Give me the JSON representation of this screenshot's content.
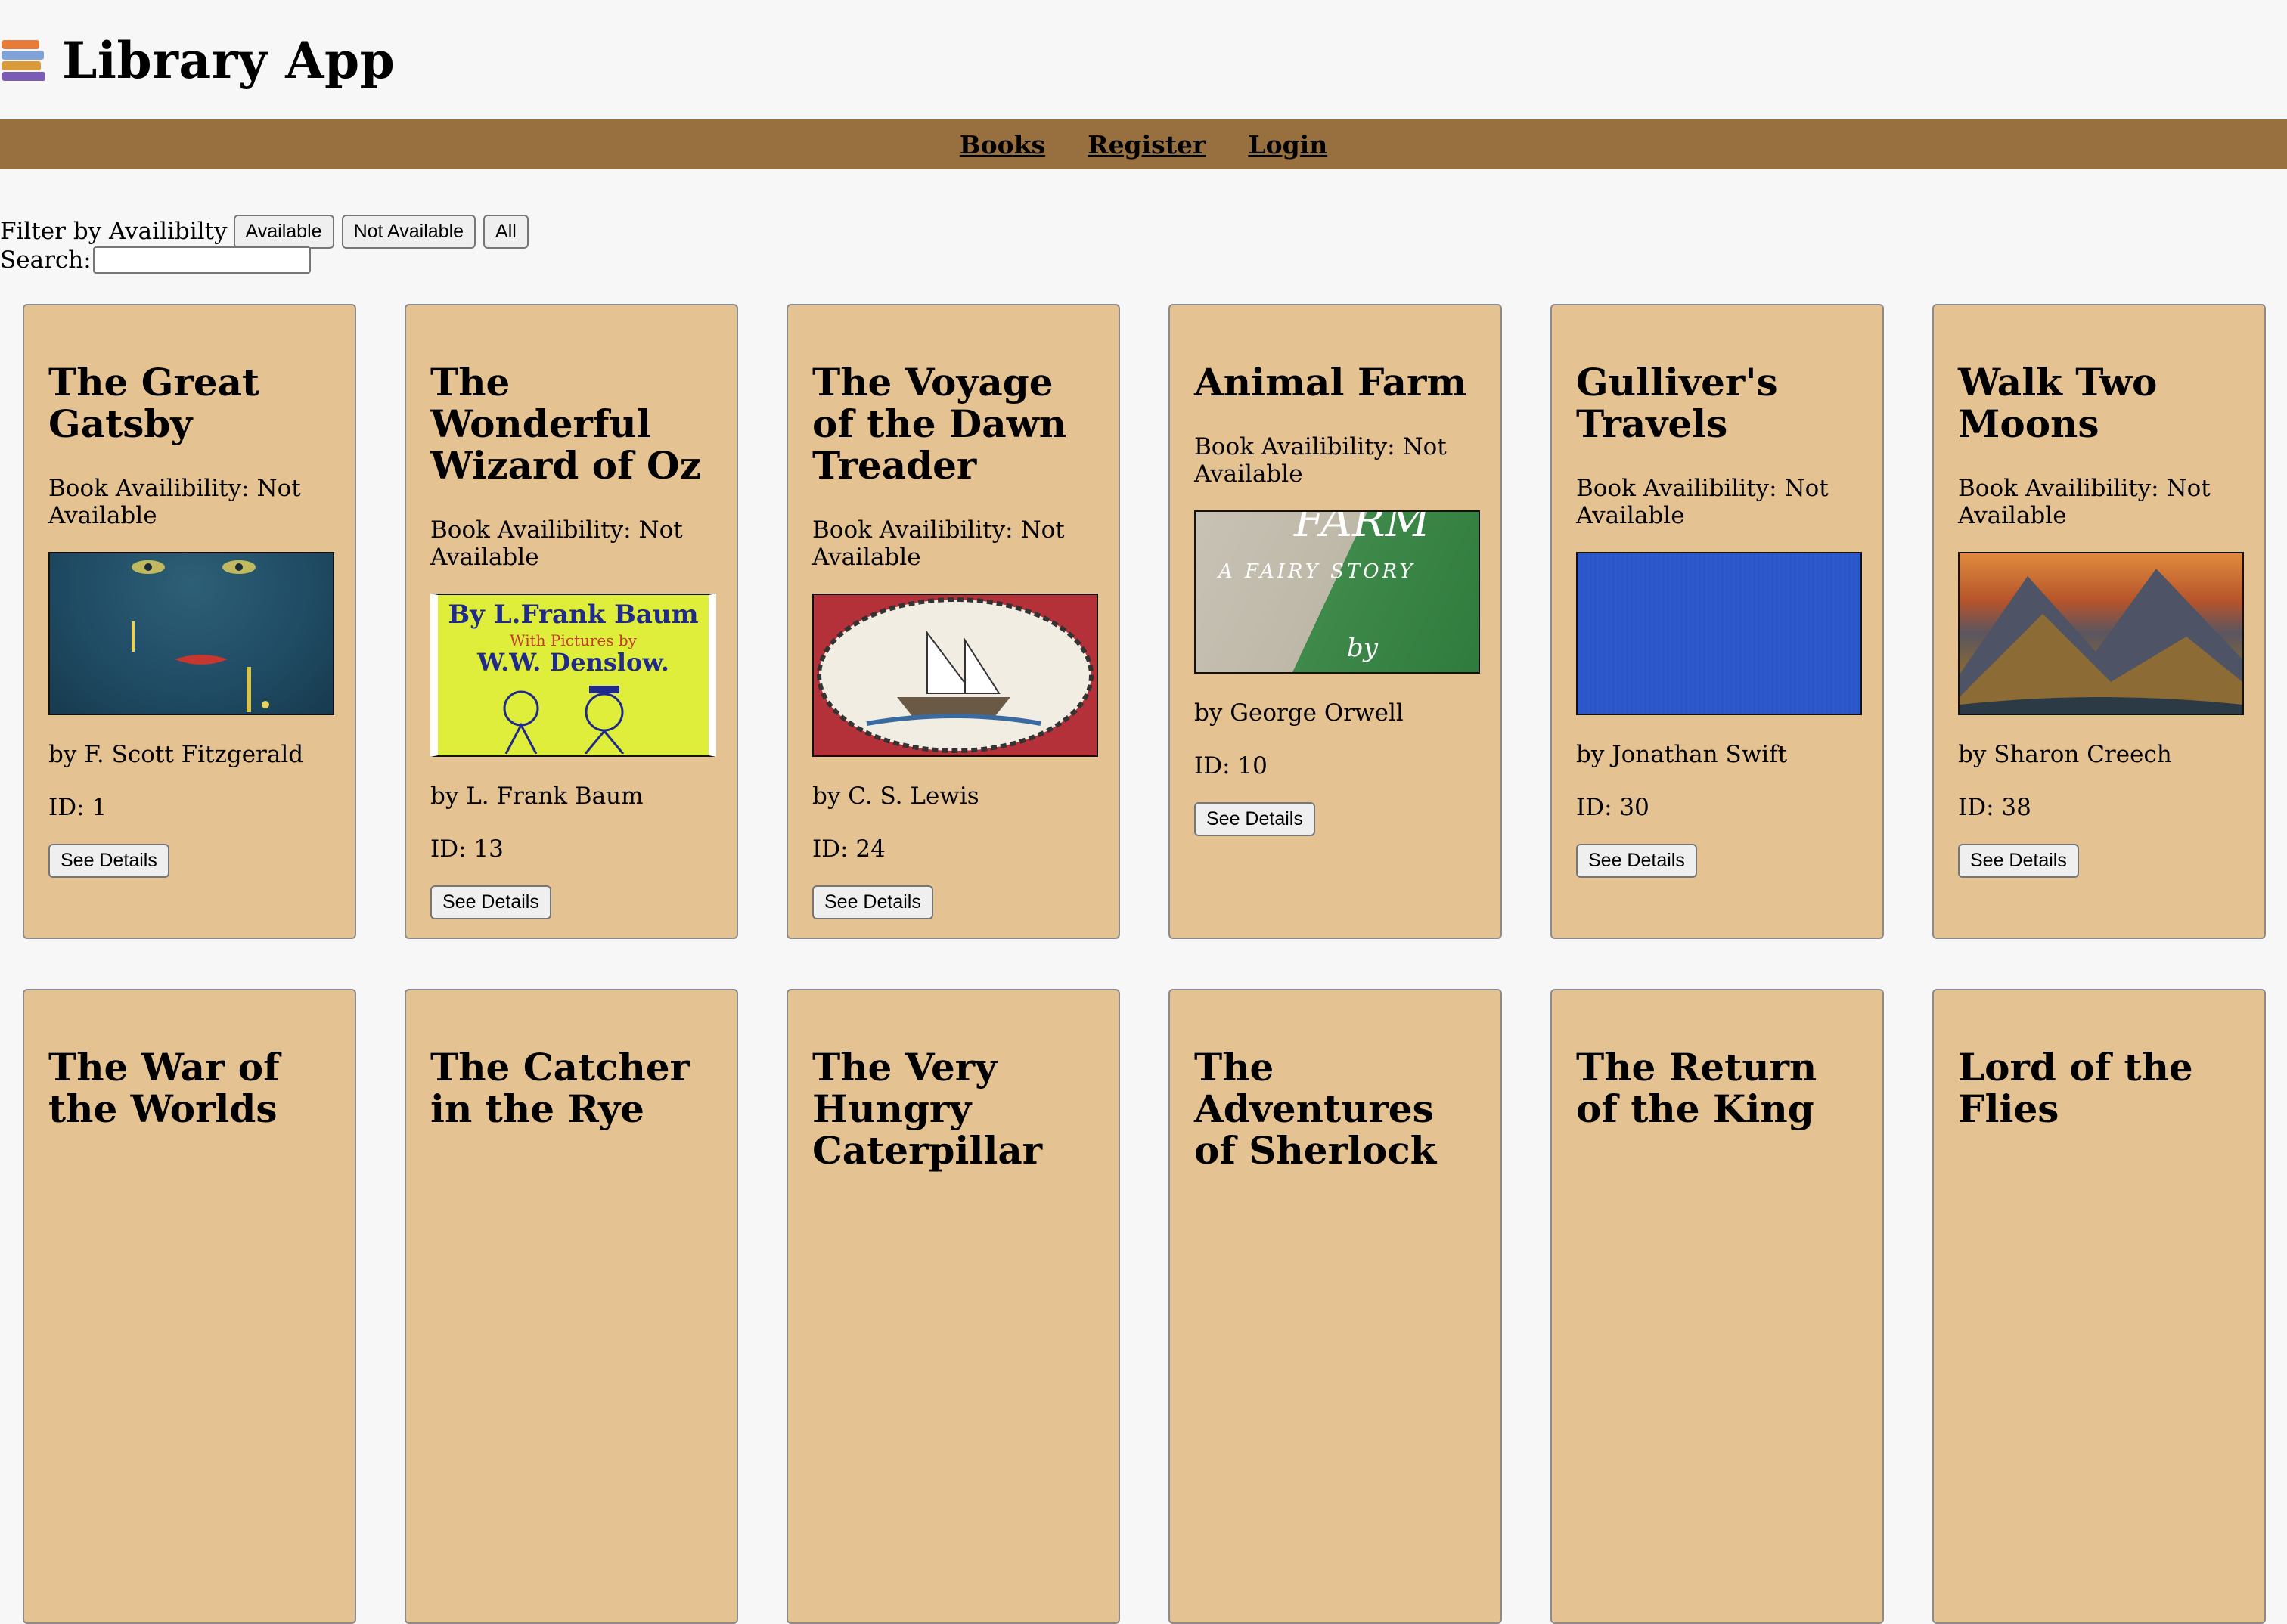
{
  "app": {
    "title": "Library App",
    "logo_icon": "books-stack-icon"
  },
  "nav": {
    "items": [
      "Books",
      "Register",
      "Login"
    ]
  },
  "filter": {
    "label": "Filter by Availibilty",
    "buttons": [
      "Available",
      "Not Available",
      "All"
    ]
  },
  "search": {
    "label": "Search:",
    "value": "",
    "placeholder": ""
  },
  "colors": {
    "nav_bg": "#98703f",
    "card_bg": "#e4c291",
    "page_bg": "#f7f7f7"
  },
  "books": [
    {
      "title": "The Great Gatsby",
      "availability": "Book Availibility: Not Available",
      "author": "by F. Scott Fitzgerald",
      "id": "ID: 1",
      "button": "See Details"
    },
    {
      "title": "The Wonderful Wizard of Oz",
      "availability": "Book Availibility: Not Available",
      "author": "by L. Frank Baum",
      "id": "ID: 13",
      "button": "See Details",
      "cover_text": {
        "line1": "By L.Frank Baum",
        "line2": "With Pictures by",
        "line3": "W.W. Denslow."
      }
    },
    {
      "title": "The Voyage of the Dawn Treader",
      "availability": "Book Availibility: Not Available",
      "author": "by C. S. Lewis",
      "id": "ID: 24",
      "button": "See Details"
    },
    {
      "title": "Animal Farm",
      "availability": "Book Availibility: Not Available",
      "author": "by George Orwell",
      "id": "ID: 10",
      "button": "See Details",
      "cover_text": {
        "line1": "FARM",
        "line2": "A FAIRY STORY",
        "line3": "by"
      }
    },
    {
      "title": "Gulliver's Travels",
      "availability": "Book Availibility: Not Available",
      "author": "by Jonathan Swift",
      "id": "ID: 30",
      "button": "See Details"
    },
    {
      "title": "Walk Two Moons",
      "availability": "Book Availibility: Not Available",
      "author": "by Sharon Creech",
      "id": "ID: 38",
      "button": "See Details"
    },
    {
      "title": "The War of the Worlds"
    },
    {
      "title": "The Catcher in the Rye"
    },
    {
      "title": "The Very Hungry Caterpillar"
    },
    {
      "title": "The Adventures of Sherlock"
    },
    {
      "title": "The Return of the King"
    },
    {
      "title": "Lord of the Flies"
    }
  ]
}
